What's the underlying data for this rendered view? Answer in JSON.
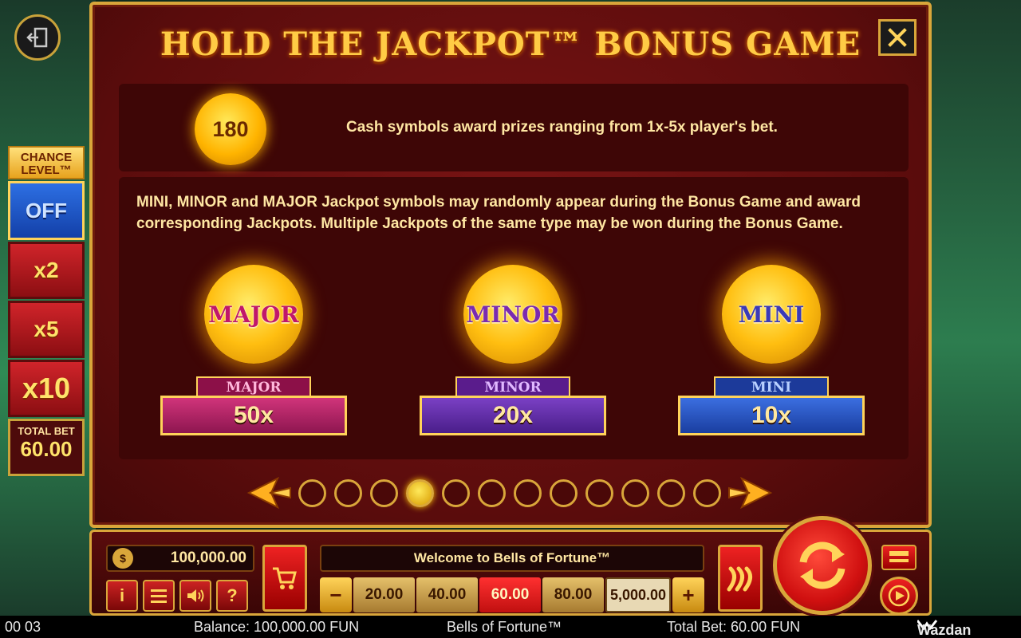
{
  "panel": {
    "title": "HOLD THE JACKPOT™ BONUS GAME",
    "cash_coin_value": "180",
    "cash_text": "Cash symbols award prizes ranging from 1x-5x player's bet.",
    "jackpot_text": "MINI, MINOR and MAJOR Jackpot symbols may randomly appear during the Bonus Game and award corresponding Jackpots. Multiple Jackpots of the same type may be won during the Bonus Game.",
    "jackpots": [
      {
        "coin_label": "MAJOR",
        "tag": "MAJOR",
        "value": "50x",
        "color": "#c0176b"
      },
      {
        "coin_label": "MINOR",
        "tag": "MINOR",
        "value": "20x",
        "color": "#7a2bb0"
      },
      {
        "coin_label": "MINI",
        "tag": "MINI",
        "value": "10x",
        "color": "#3a3ab8"
      }
    ],
    "pagination": {
      "total": 12,
      "current": 4
    }
  },
  "chance_level": {
    "title_line1": "CHANCE",
    "title_line2": "LEVEL™",
    "options": [
      "OFF",
      "x2",
      "x5",
      "x10"
    ],
    "selected": "OFF",
    "total_bet_label": "TOTAL BET",
    "total_bet_value": "60.00"
  },
  "bottom": {
    "balance_icon": "$",
    "balance": "100,000.00",
    "message": "Welcome to Bells of Fortune™",
    "minus": "−",
    "plus": "+",
    "bets": [
      "20.00",
      "40.00",
      "60.00",
      "80.00"
    ],
    "selected_bet": "60.00",
    "custom_bet": "5,000.00",
    "info_label": "i",
    "help_label": "?"
  },
  "status": {
    "time": "00 03",
    "balance": "Balance: 100,000.00 FUN",
    "game": "Bells of Fortune™",
    "total_bet": "Total Bet: 60.00 FUN",
    "brand": "Wazdan"
  },
  "colors": {
    "gold": "#d9a63a",
    "panel_red": "#5a0c0c",
    "text_cream": "#ffe7a3"
  }
}
